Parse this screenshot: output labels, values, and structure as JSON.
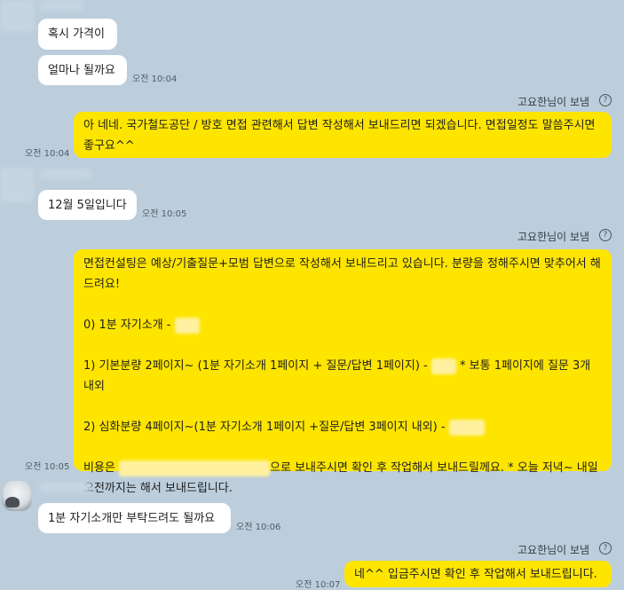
{
  "messages": {
    "m1": "혹시 가격이",
    "m2": "얼마나 될까요",
    "m2_time": "오전 10:04",
    "sender1": "고요한님이 보냄",
    "m3": "아 네네. 국가철도공단 / 방호 면접 관련해서 답변 작성해서 보내드리면 되겠습니다. 면접일정도 말씀주시면 좋구요^^",
    "m3_time": "오전 10:04",
    "m4": "12월 5일입니다",
    "m4_time": "오전 10:05",
    "sender2": "고요한님이 보냄",
    "m5_l1": "면접컨설팅은 예상/기출질문+모범 답변으로 작성해서 보내드리고 있습니다. 분량을 정해주시면 맞추어서 해드려요!",
    "m5_l2": "0) 1분 자기소개 -",
    "m5_l3a": "1) 기본분량 2페이지~ (1분 자기소개 1페이지 + 질문/답변 1페이지) -",
    "m5_l3b": "* 보통 1페이지에 질문 3개 내외",
    "m5_l4": "2) 심화분량 4페이지~(1분 자기소개 1페이지 +질문/답변 3페이지 내외) -",
    "m5_l5a": "비용은",
    "m5_l5b": "으로 보내주시면 확인 후 작업해서 보내드릴께요. * 오늘 저녁~ 내일 오전까지는 해서 보내드립니다.",
    "m5_time": "오전 10:05",
    "m6": "1분 자기소개만 부탁드려도 될까요",
    "m6_time": "오전 10:06",
    "sender3": "고요한님이 보냄",
    "m7": "네^^ 입금주시면 확인 후 작업해서 보내드립니다.",
    "m7_time": "오전 10:07",
    "help_glyph": "?"
  },
  "colors": {
    "background": "#bccedc",
    "incoming": "#ffffff",
    "outgoing": "#fee500"
  }
}
